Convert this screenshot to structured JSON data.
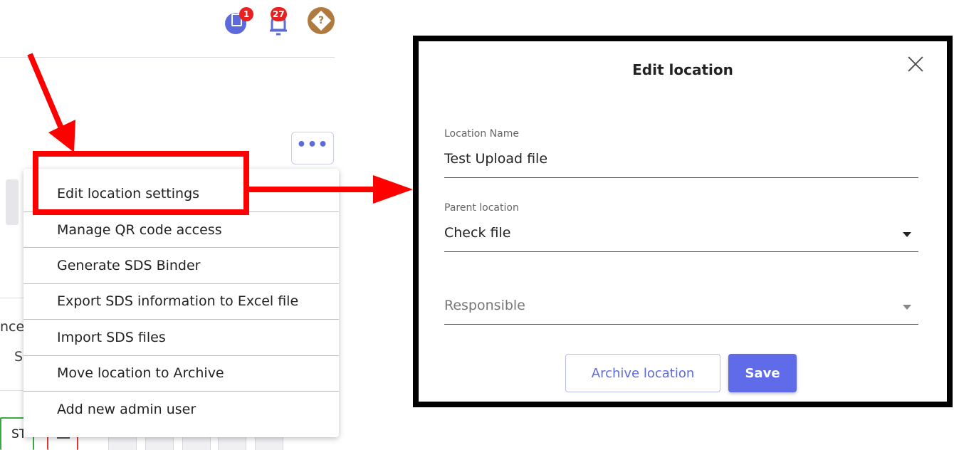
{
  "header": {
    "notes_badge": "1",
    "alerts_badge": "27",
    "help_icon": "help-diamond-icon"
  },
  "background": {
    "partial_text_1": "nce",
    "partial_text_2": "S",
    "bottom_tab_label": "ST"
  },
  "more_button": {
    "label": "•••"
  },
  "menu": {
    "items": [
      {
        "label": "Edit location settings"
      },
      {
        "label": "Manage QR code access"
      },
      {
        "label": "Generate SDS Binder"
      },
      {
        "label": "Export SDS information to Excel file"
      },
      {
        "label": "Import SDS files"
      },
      {
        "label": "Move location to Archive"
      },
      {
        "label": "Add new admin user"
      }
    ]
  },
  "modal": {
    "title": "Edit location",
    "location_name": {
      "label": "Location Name",
      "value": "Test Upload file"
    },
    "parent_location": {
      "label": "Parent location",
      "value": "Check file"
    },
    "responsible": {
      "placeholder": "Responsible"
    },
    "archive_button": "Archive location",
    "save_button": "Save"
  },
  "colors": {
    "accent": "#5f6be8",
    "annotation_red": "#ff0000",
    "badge_red": "#e82020"
  }
}
